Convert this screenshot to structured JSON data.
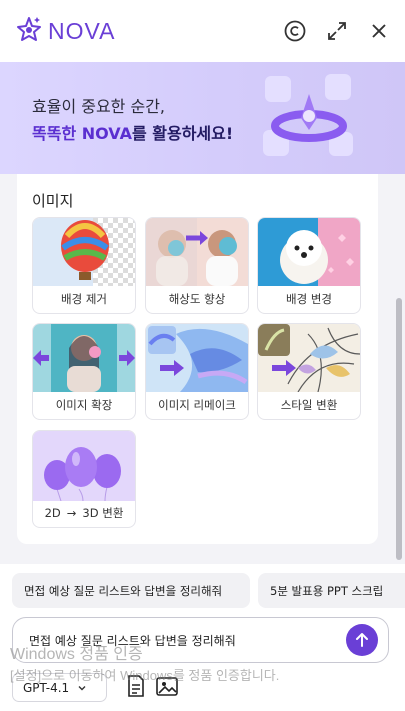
{
  "header": {
    "app_name": "NOVA",
    "logo_icon": "nova-star-logo",
    "actions": [
      "copyright-icon",
      "expand-icon",
      "close-icon"
    ]
  },
  "banner": {
    "line1": "효율이 중요한 순간,",
    "line2_highlight": "똑똑한 NOVA",
    "line2_rest": "를 활용하세요!"
  },
  "section": {
    "title": "이미지",
    "tiles": [
      {
        "label": "배경 제거"
      },
      {
        "label": "해상도 향상"
      },
      {
        "label": "배경 변경"
      },
      {
        "label": "이미지 확장"
      },
      {
        "label": "이미지 리메이크"
      },
      {
        "label": "스타일 변환"
      },
      {
        "label_from": "2D",
        "label_arrow": "→",
        "label_to": "3D 변환"
      }
    ]
  },
  "suggestions": [
    "면접 예상 질문 리스트와 답변을 정리해줘",
    "5분 발표용 PPT 스크립"
  ],
  "composer": {
    "value": "면접 예상 질문 리스트와 답변을 정리해줘",
    "model": "GPT-4.1"
  },
  "watermark": {
    "line1": "Windows 정품 인증",
    "line2": "[설정]으로 이동하여 Windows를 정품 인증합니다."
  },
  "colors": {
    "accent": "#6a3fd6",
    "banner_bg": "#d8d1fd"
  }
}
